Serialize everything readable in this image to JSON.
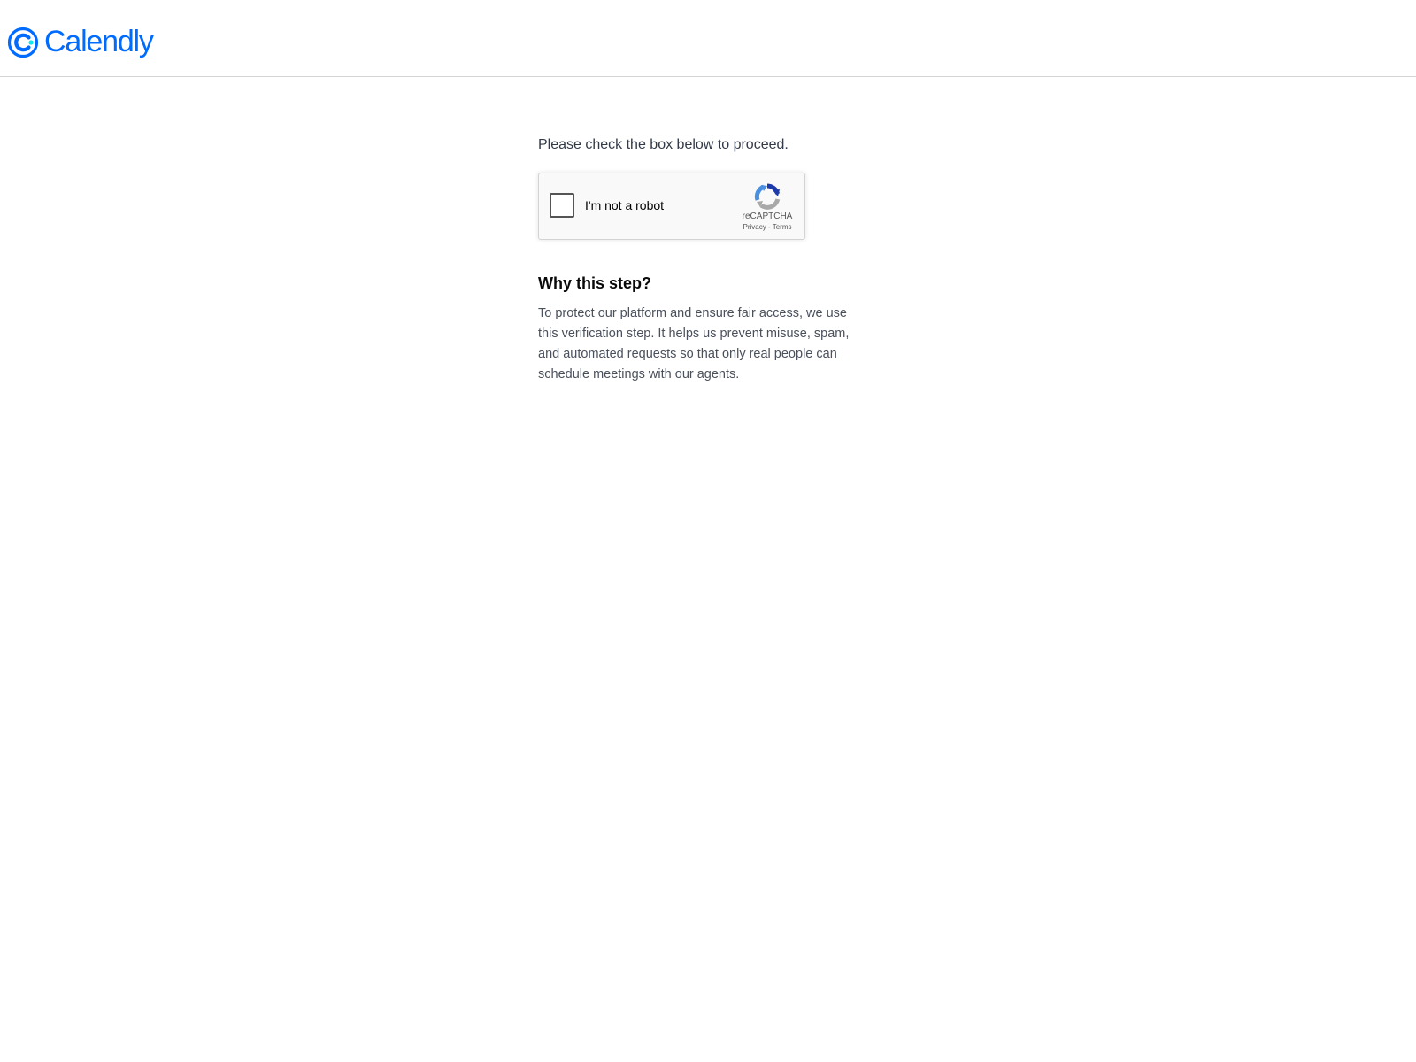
{
  "header": {
    "logo_text": "Calendly",
    "brand_color": "#006bff"
  },
  "main": {
    "instruction": "Please check the box below to proceed.",
    "captcha": {
      "label": "I'm not a robot",
      "brand": "reCAPTCHA",
      "privacy_link": "Privacy",
      "separator": "-",
      "terms_link": "Terms",
      "checked": false
    },
    "why": {
      "title": "Why this step?",
      "body": "To protect our platform and ensure fair access, we use this verification step. It helps us prevent misuse, spam, and automated requests so that only real people can schedule meetings with our agents."
    }
  },
  "icons": {
    "logo": "calendly-logo-icon",
    "captcha": "recaptcha-logo-icon"
  }
}
